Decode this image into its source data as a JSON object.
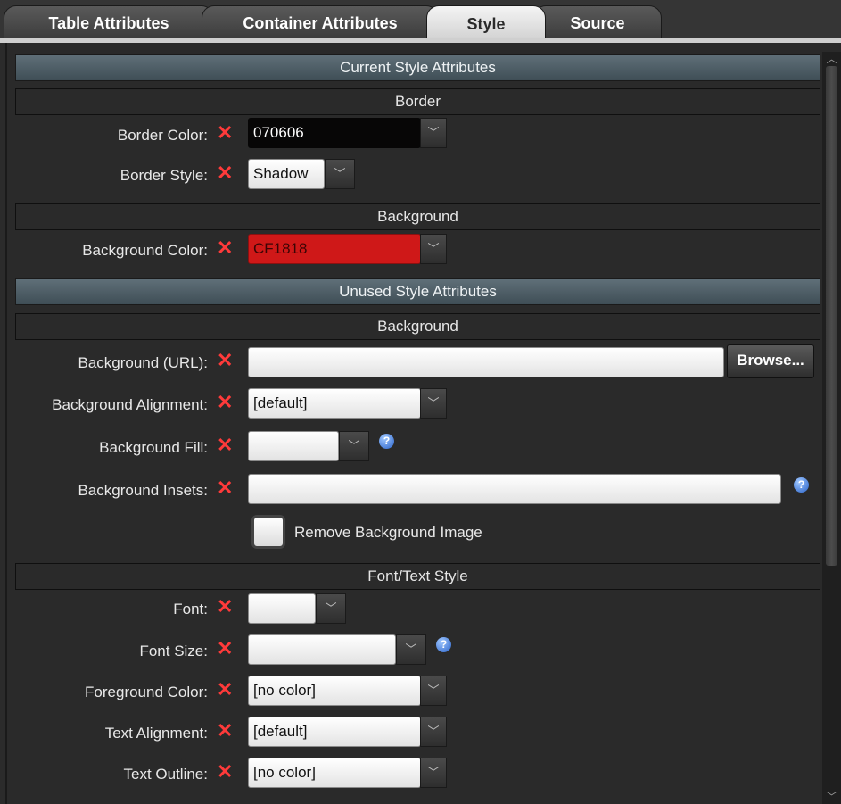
{
  "tabs": [
    {
      "label": "Table Attributes"
    },
    {
      "label": "Container Attributes"
    },
    {
      "label": "Style"
    },
    {
      "label": "Source"
    }
  ],
  "sections": {
    "current": "Current Style Attributes",
    "unused": "Unused Style Attributes",
    "border": "Border",
    "background_current": "Background",
    "background_unused": "Background",
    "font_text": "Font/Text Style"
  },
  "current": {
    "border_color": {
      "label": "Border Color:",
      "value": "070606",
      "swatch": "#070606"
    },
    "border_style": {
      "label": "Border Style:",
      "value": "Shadow"
    },
    "background_color": {
      "label": "Background Color:",
      "value": "CF1818",
      "swatch": "#CF1818"
    }
  },
  "unused": {
    "background_url": {
      "label": "Background (URL):",
      "value": "",
      "button": "Browse..."
    },
    "background_alignment": {
      "label": "Background Alignment:",
      "value": "[default]"
    },
    "background_fill": {
      "label": "Background Fill:",
      "value": ""
    },
    "background_insets": {
      "label": "Background Insets:",
      "value": ""
    },
    "remove_background_image": {
      "label": "Remove Background Image",
      "checked": false
    },
    "font": {
      "label": "Font:",
      "value": ""
    },
    "font_size": {
      "label": "Font Size:",
      "value": ""
    },
    "foreground_color": {
      "label": "Foreground Color:",
      "value": "[no color]"
    },
    "text_alignment": {
      "label": "Text Alignment:",
      "value": "[default]"
    },
    "text_outline": {
      "label": "Text Outline:",
      "value": "[no color]"
    }
  },
  "icons": {
    "remove": "close-icon",
    "dropdown": "chevron-down-icon",
    "help": "help-icon"
  },
  "colors": {
    "remove_icon": "#ff3a3a",
    "section_header": "#4f5f68"
  }
}
